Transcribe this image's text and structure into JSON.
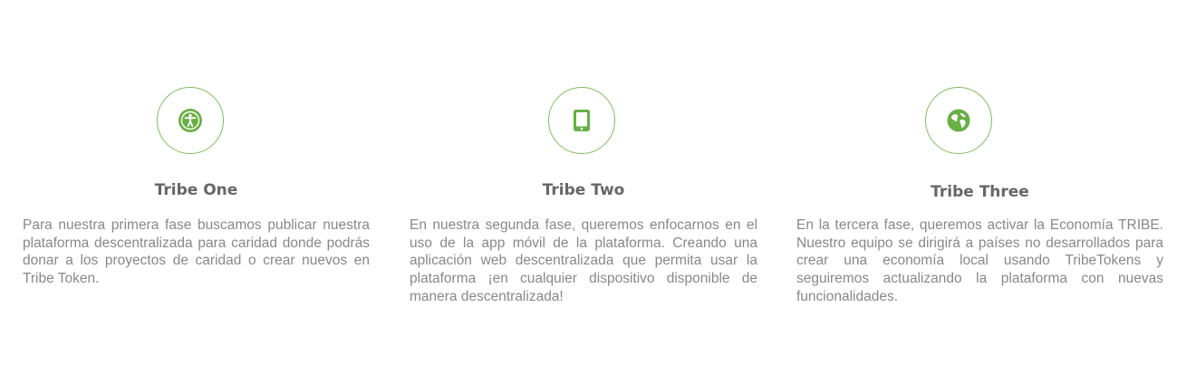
{
  "colors": {
    "accent": "#6aaf45",
    "circle_border": "#7cbf5c",
    "title": "#666666",
    "text": "#888888"
  },
  "features": [
    {
      "icon": "accessibility-icon",
      "title": "Tribe One",
      "description": "Para nuestra primera fase buscamos publicar nuestra plataforma descentralizada para caridad donde podrás donar a los proyectos de caridad o crear nuevos en Tribe Token."
    },
    {
      "icon": "tablet-icon",
      "title": "Tribe Two",
      "description": "En nuestra segunda fase, queremos enfocarnos en el uso de la app móvil de la plataforma. Creando una aplicación web descentralizada que permita usar la plataforma ¡en cualquier dispositivo disponible de manera descentralizada!"
    },
    {
      "icon": "globe-icon",
      "title": "Tribe Three",
      "description": "En la tercera fase, queremos activar la Economía TRIBE. Nuestro equipo se dirigirá a países no desarrollados para crear una economía local usando TribeTokens y seguiremos actualizando la plataforma con nuevas funcionalidades."
    }
  ]
}
